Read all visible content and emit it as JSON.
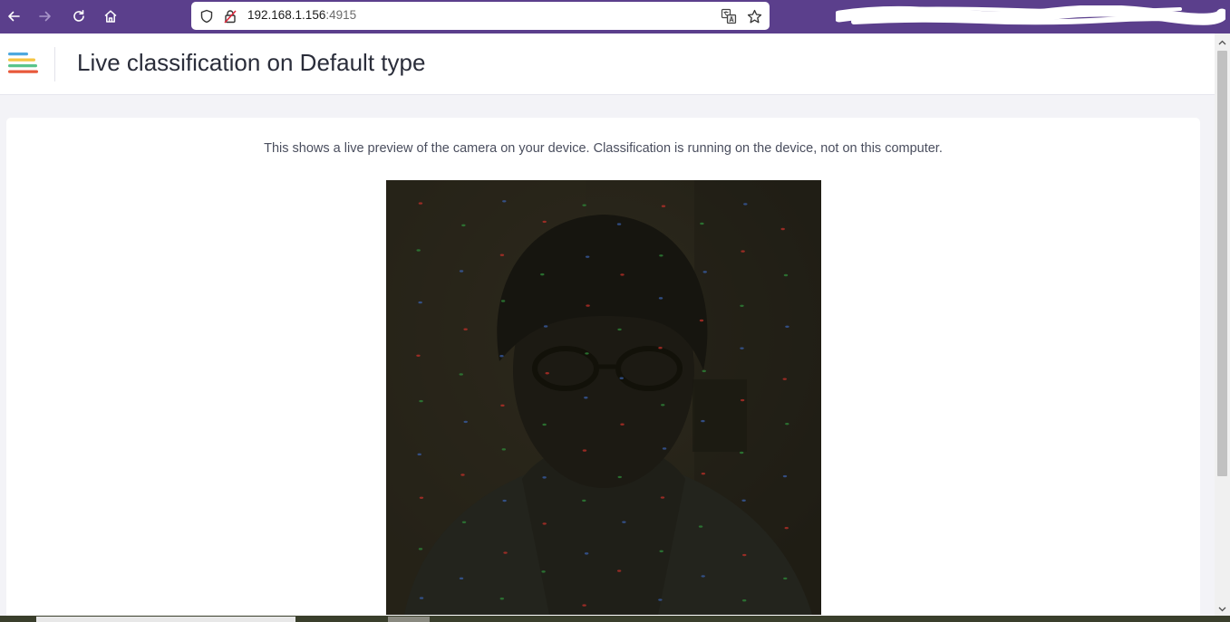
{
  "browser": {
    "url_host": "192.168.1.156",
    "url_port": ":4915"
  },
  "header": {
    "title": "Live classification on Default type",
    "logo_colors": [
      "#4ea8de",
      "#f5c542",
      "#59c48b",
      "#e8593b"
    ]
  },
  "main": {
    "description": "This shows a live preview of the camera on your device. Classification is running on the device, not on this computer."
  },
  "icons": {
    "back": "arrow-left-icon",
    "forward": "arrow-right-icon",
    "reload": "reload-icon",
    "home": "home-icon",
    "shield": "shield-icon",
    "insecure": "insecure-lock-icon",
    "translate": "translate-icon",
    "bookmark": "star-icon"
  },
  "colors": {
    "browser_accent": "#5b3f8c",
    "camera_background": "#27241a"
  }
}
